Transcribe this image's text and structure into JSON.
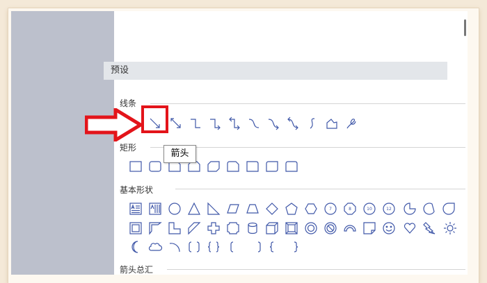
{
  "panel": {
    "preset_header": "预设",
    "sections": [
      {
        "id": "lines",
        "label": "线条"
      },
      {
        "id": "rect",
        "label": "矩形"
      },
      {
        "id": "basic",
        "label": "基本形状"
      },
      {
        "id": "arrows",
        "label": "箭头总汇"
      }
    ],
    "tooltip": "箭头",
    "line_shapes": [
      "line-icon",
      "arrow-line-icon",
      "elbow-connector-icon",
      "elbow-arrow-connector-icon",
      "elbow-double-arrow-connector-icon",
      "curved-connector-icon",
      "curved-arrow-connector-icon",
      "curved-double-arrow-connector-icon",
      "curve-icon",
      "freeform-icon",
      "scribble-icon"
    ],
    "rect_shapes": [
      "rectangle-icon",
      "rounded-rectangle-icon",
      "snip-single-corner-rectangle-icon",
      "snip-same-side-corner-rectangle-icon",
      "snip-diagonal-corner-rectangle-icon",
      "snip-round-single-corner-rectangle-icon",
      "snip-round-same-side-rectangle-icon",
      "round-diagonal-corner-rectangle-icon",
      "round-same-side-corner-rectangle-icon"
    ],
    "basic_shapes_row1": [
      "text-box-icon",
      "vertical-text-box-icon",
      "oval-icon",
      "isosceles-triangle-icon",
      "right-triangle-icon",
      "parallelogram-icon",
      "trapezoid-icon",
      "diamond-icon",
      "pentagon-icon",
      "hexagon-icon",
      "heptagon-icon",
      "octagon-icon",
      "decagon-icon",
      "dodecagon-icon",
      "pie-icon",
      "chord-icon",
      "teardrop-icon"
    ],
    "basic_shapes_row2": [
      "frame-icon",
      "half-frame-icon",
      "l-shape-icon",
      "diagonal-stripe-icon",
      "cross-icon",
      "plaque-icon",
      "can-icon",
      "cube-icon",
      "bevel-icon",
      "donut-icon",
      "no-symbol-icon",
      "block-arc-icon",
      "folded-corner-icon",
      "smiley-face-icon",
      "heart-icon",
      "lightning-bolt-icon",
      "sun-icon"
    ],
    "basic_shapes_row3": [
      "moon-icon",
      "cloud-icon",
      "arc-icon",
      "double-bracket-icon",
      "double-brace-icon",
      "left-bracket-icon",
      "right-bracket-icon",
      "left-brace-icon",
      "right-brace-icon"
    ],
    "polygon_numbers": {
      "heptagon": "7",
      "octagon": "8",
      "decagon": "10",
      "dodecagon": "12"
    },
    "accent_color": "#3f57a8",
    "highlight_color": "#e3141a"
  }
}
